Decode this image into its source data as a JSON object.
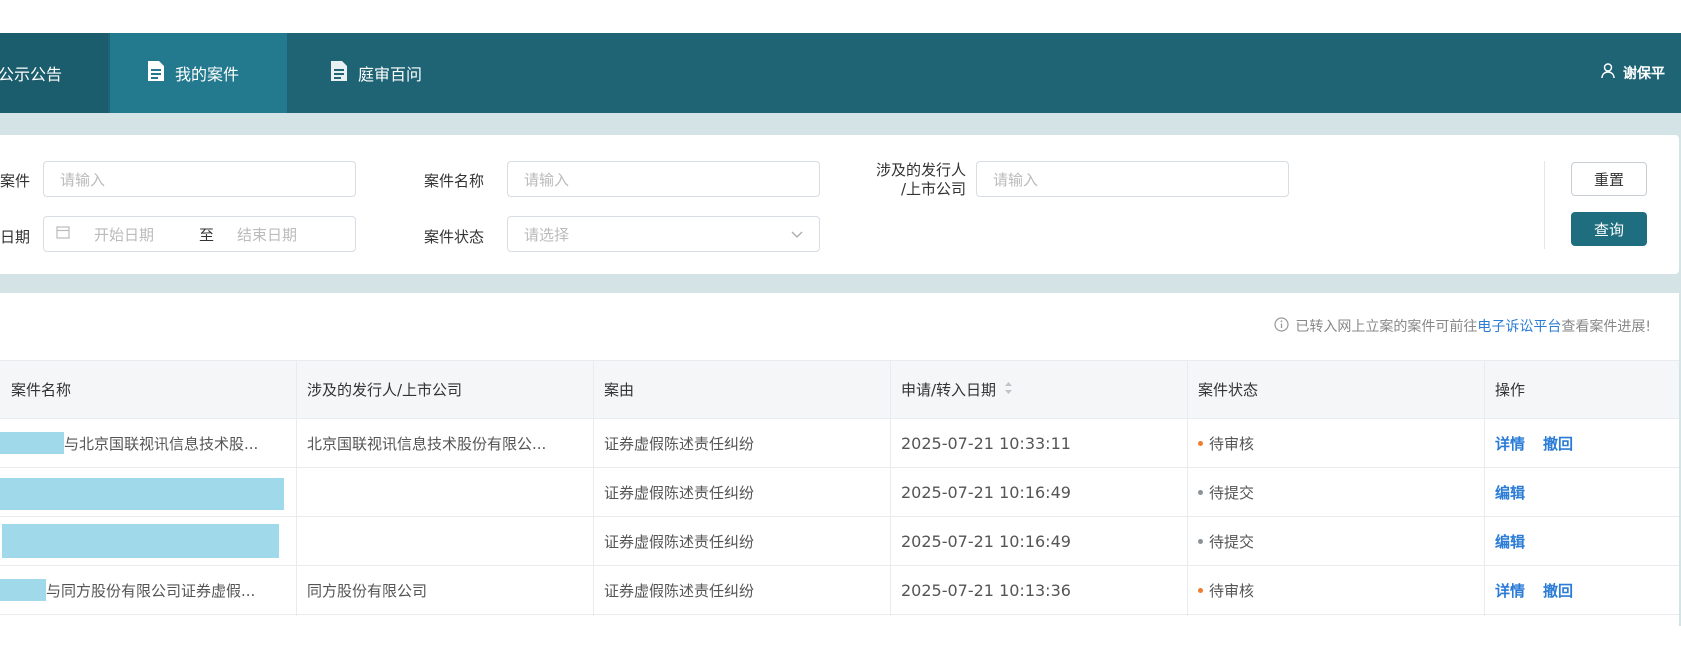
{
  "nav": {
    "items": [
      {
        "label": "公示公告",
        "icon": "none",
        "active": false
      },
      {
        "label": "我的案件",
        "icon": "document-icon",
        "active": true
      },
      {
        "label": "庭审百问",
        "icon": "document-icon",
        "active": false
      }
    ],
    "user_name": "谢保平",
    "user_icon": "user-icon"
  },
  "filters": {
    "case_label": "案件",
    "case_placeholder": "请输入",
    "case_name_label": "案件名称",
    "case_name_placeholder": "请输入",
    "issuer_label_line1": "涉及的发行人",
    "issuer_label_line2": "/上市公司",
    "issuer_placeholder": "请输入",
    "date_label": "日期",
    "date_start_placeholder": "开始日期",
    "date_separator": "至",
    "date_end_placeholder": "结束日期",
    "status_label": "案件状态",
    "status_placeholder": "请选择",
    "reset_label": "重置",
    "query_label": "查询"
  },
  "notice": {
    "prefix": "已转入网上立案的案件可前往",
    "link": "电子诉讼平台",
    "suffix": "查看案件进展!"
  },
  "table": {
    "columns": [
      "案件名称",
      "涉及的发行人/上市公司",
      "案由",
      "申请/转入日期",
      "案件状态",
      "操作"
    ],
    "rows": [
      {
        "name": "与北京国联视讯信息技术股...",
        "issuer": "北京国联视讯信息技术股份有限公...",
        "cause": "证券虚假陈述责任纠纷",
        "date": "2025-07-21 10:33:11",
        "status": "待审核",
        "status_color": "#f07d2e",
        "actions": [
          "详情",
          "撤回"
        ]
      },
      {
        "name": "",
        "issuer": "",
        "cause": "证券虚假陈述责任纠纷",
        "date": "2025-07-21 10:16:49",
        "status": "待提交",
        "status_color": "#8a9299",
        "actions": [
          "编辑"
        ]
      },
      {
        "name": "",
        "issuer": "",
        "cause": "证券虚假陈述责任纠纷",
        "date": "2025-07-21 10:16:49",
        "status": "待提交",
        "status_color": "#8a9299",
        "actions": [
          "编辑"
        ]
      },
      {
        "name": "与同方股份有限公司证券虚假...",
        "issuer": "同方股份有限公司",
        "cause": "证券虚假陈述责任纠纷",
        "date": "2025-07-21 10:13:36",
        "status": "待审核",
        "status_color": "#f07d2e",
        "actions": [
          "详情",
          "撤回"
        ]
      }
    ]
  },
  "colors": {
    "topbar": "#1f6475",
    "nav_active": "#23798e",
    "primary_button": "#1f6e80",
    "link": "#2b7cd6",
    "pending_review": "#f07d2e",
    "pending_submit": "#8a9299"
  }
}
